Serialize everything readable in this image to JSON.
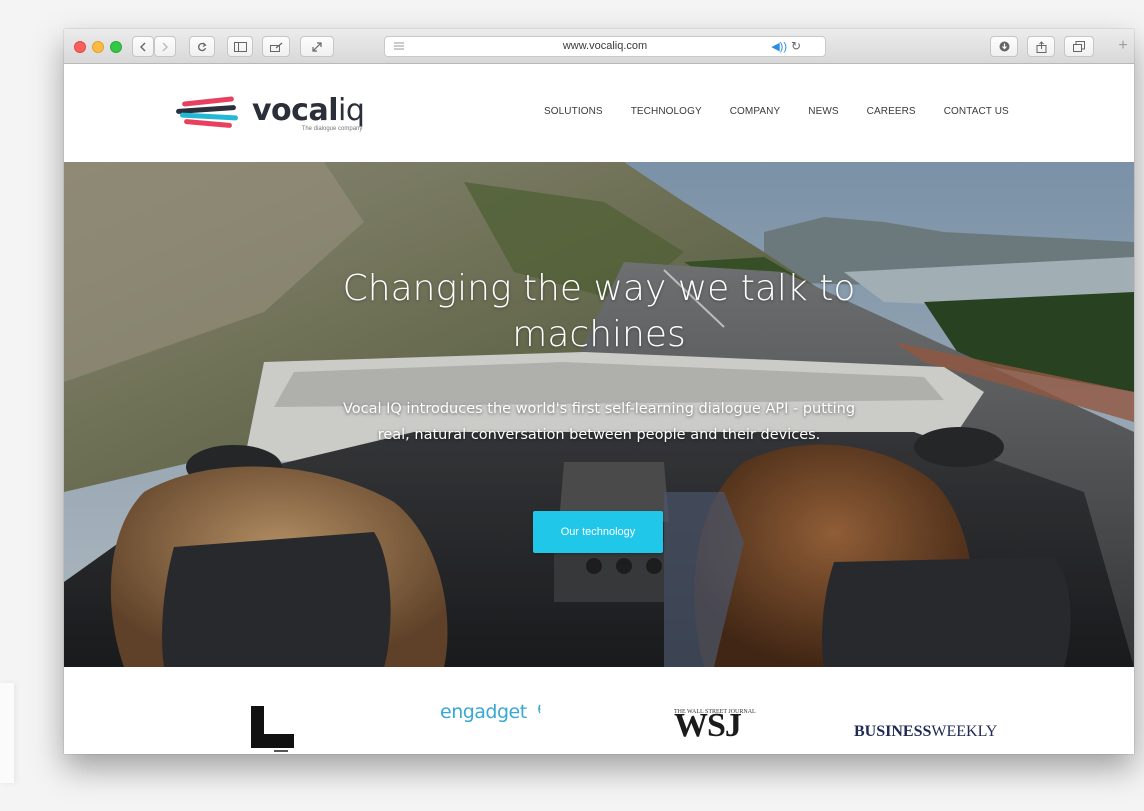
{
  "browser": {
    "url": "www.vocaliq.com",
    "buttons": [
      "back-icon",
      "forward-icon",
      "reload-icon",
      "sidebar-icon",
      "share-icon",
      "fullscreen-icon"
    ],
    "right_buttons": [
      "download-icon",
      "share-icon",
      "tabs-icon"
    ],
    "new_tab": "+"
  },
  "site": {
    "logo": {
      "word_bold": "vocal",
      "word_light": "iq",
      "tagline": "The dialogue company"
    },
    "nav": [
      "SOLUTIONS",
      "TECHNOLOGY",
      "COMPANY",
      "NEWS",
      "CAREERS",
      "CONTACT US"
    ],
    "hero": {
      "title": "Changing the way we talk to machines",
      "subtitle": "Vocal IQ introduces the world's first self-learning dialogue API - putting real, natural conversation between people and their devices.",
      "cta": "Our technology"
    },
    "press": {
      "engadget": "engadget",
      "wsj": "WSJ",
      "wsj_top": "THE WALL STREET JOURNAL",
      "bw_bold": "BUSINESS",
      "bw_light": "WEEKLY"
    }
  },
  "colors": {
    "accent": "#20c7e8",
    "logo_stripes": [
      "#e8415f",
      "#2a2f3a",
      "#22b8d6",
      "#e8415f"
    ]
  }
}
